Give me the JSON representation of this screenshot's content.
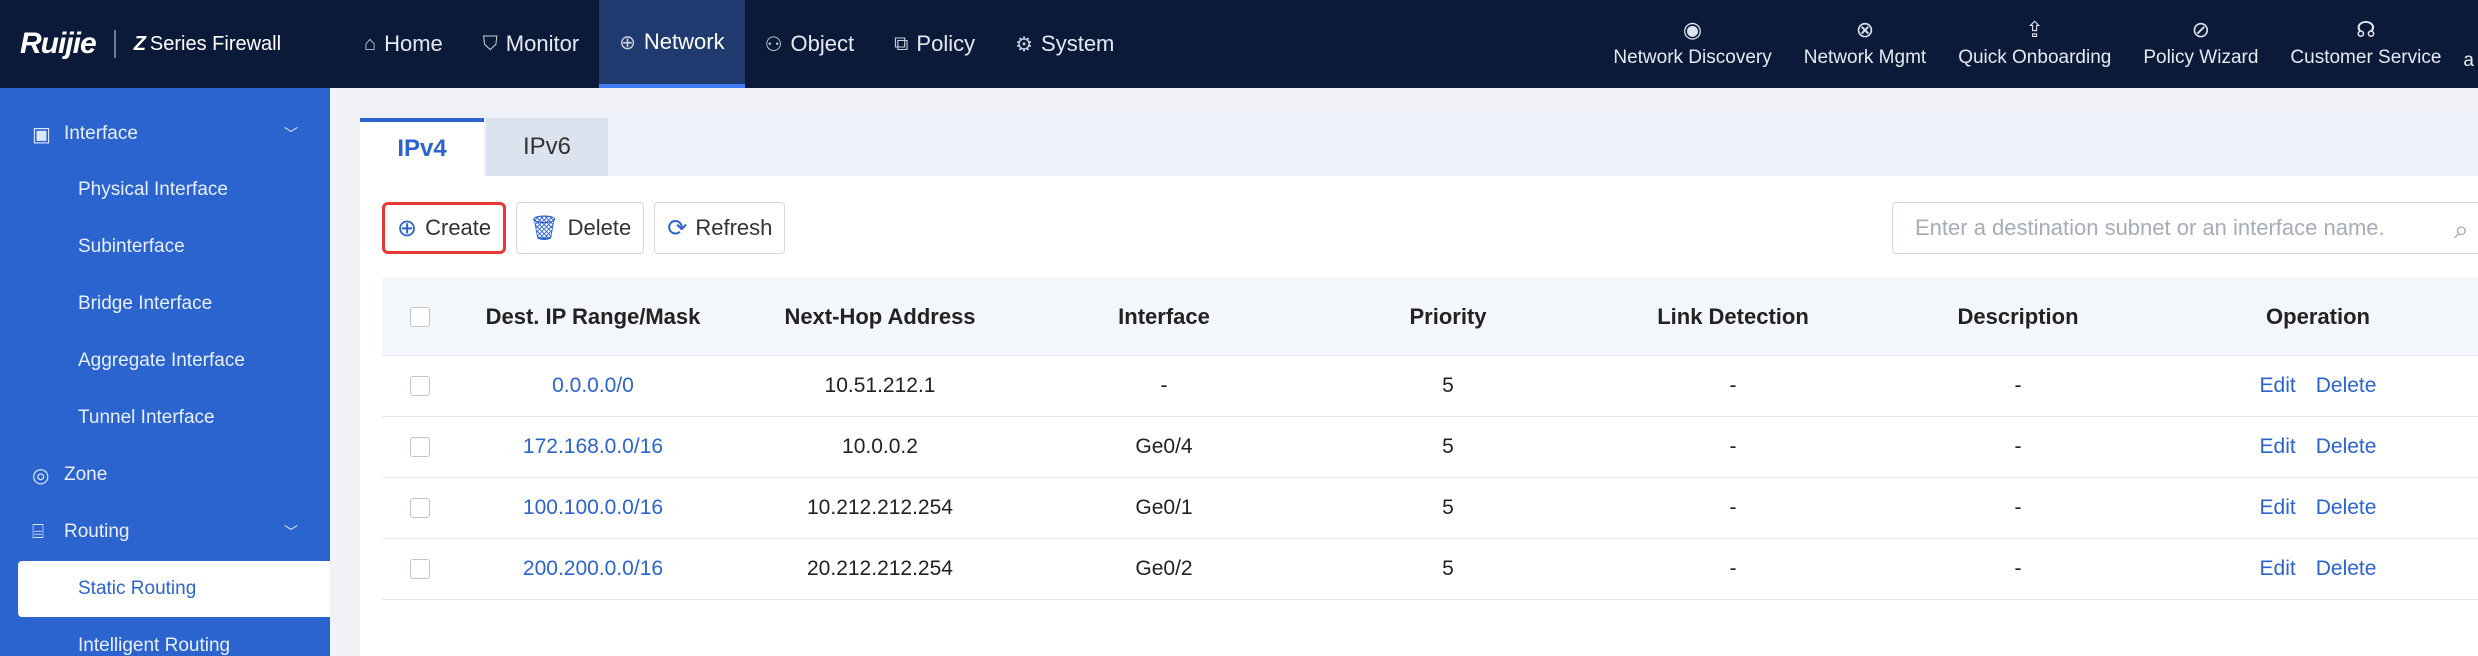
{
  "brand": {
    "logo": "Ruijie",
    "product_prefix": "Z",
    "product": "Series Firewall"
  },
  "nav": [
    {
      "label": "Home",
      "icon": "home-icon",
      "glyph": "⌂",
      "active": false
    },
    {
      "label": "Monitor",
      "icon": "shield-icon",
      "glyph": "⛉",
      "active": false
    },
    {
      "label": "Network",
      "icon": "globe-icon",
      "glyph": "⊕",
      "active": true
    },
    {
      "label": "Object",
      "icon": "user-object-icon",
      "glyph": "⚇",
      "active": false
    },
    {
      "label": "Policy",
      "icon": "policy-icon",
      "glyph": "⧉",
      "active": false
    },
    {
      "label": "System",
      "icon": "gear-icon",
      "glyph": "⚙",
      "active": false
    }
  ],
  "right_nav": [
    {
      "label": "Network Discovery",
      "icon": "signal-icon",
      "glyph": "◉"
    },
    {
      "label": "Network Mgmt",
      "icon": "network-mgmt-icon",
      "glyph": "⊗"
    },
    {
      "label": "Quick Onboarding",
      "icon": "upload-icon",
      "glyph": "⇪"
    },
    {
      "label": "Policy Wizard",
      "icon": "compass-icon",
      "glyph": "⊘"
    },
    {
      "label": "Customer Service",
      "icon": "headset-icon",
      "glyph": "☊"
    },
    {
      "label": "a",
      "icon": "",
      "glyph": ""
    }
  ],
  "sidebar": {
    "groups": [
      {
        "label": "Interface",
        "icon": "interface-icon",
        "glyph": "▣",
        "expanded": true
      },
      {
        "label": "Zone",
        "icon": "zone-icon",
        "glyph": "◎",
        "expanded": false
      },
      {
        "label": "Routing",
        "icon": "routing-icon",
        "glyph": "⌸",
        "expanded": true
      }
    ],
    "items": [
      {
        "label": "Physical Interface"
      },
      {
        "label": "Subinterface"
      },
      {
        "label": "Bridge Interface"
      },
      {
        "label": "Aggregate Interface"
      },
      {
        "label": "Tunnel Interface"
      },
      {
        "label": "Static Routing",
        "active": true
      },
      {
        "label": "Intelligent Routing"
      }
    ]
  },
  "tabs": [
    {
      "label": "IPv4",
      "active": true
    },
    {
      "label": "IPv6",
      "active": false
    }
  ],
  "toolbar": {
    "create": "Create",
    "delete": "Delete",
    "refresh": "Refresh"
  },
  "search": {
    "placeholder": "Enter a destination subnet or an interface name.",
    "value": ""
  },
  "table": {
    "columns": [
      "Dest. IP Range/Mask",
      "Next-Hop Address",
      "Interface",
      "Priority",
      "Link Detection",
      "Description",
      "Operation"
    ],
    "rows": [
      {
        "dest": "0.0.0.0/0",
        "nexthop": "10.51.212.1",
        "iface": "-",
        "priority": "5",
        "link": "-",
        "desc": "-"
      },
      {
        "dest": "172.168.0.0/16",
        "nexthop": "10.0.0.2",
        "iface": "Ge0/4",
        "priority": "5",
        "link": "-",
        "desc": "-"
      },
      {
        "dest": "100.100.0.0/16",
        "nexthop": "10.212.212.254",
        "iface": "Ge0/1",
        "priority": "5",
        "link": "-",
        "desc": "-"
      },
      {
        "dest": "200.200.0.0/16",
        "nexthop": "20.212.212.254",
        "iface": "Ge0/2",
        "priority": "5",
        "link": "-",
        "desc": "-"
      }
    ],
    "op_edit": "Edit",
    "op_delete": "Delete"
  },
  "colors": {
    "topbar": "#0c1a3a",
    "sidebar": "#2b63cf",
    "accent": "#2b63cf",
    "highlight": "#e53935"
  }
}
